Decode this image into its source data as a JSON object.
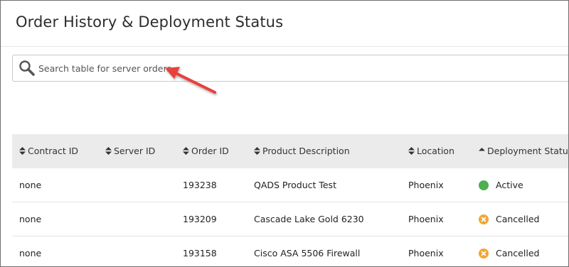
{
  "page": {
    "title": "Order History & Deployment Status"
  },
  "search": {
    "placeholder": "Search table for server orders",
    "value": ""
  },
  "table": {
    "columns": [
      {
        "label": "Contract ID",
        "sort": "both"
      },
      {
        "label": "Server ID",
        "sort": "both"
      },
      {
        "label": "Order ID",
        "sort": "both"
      },
      {
        "label": "Product Description",
        "sort": "both"
      },
      {
        "label": "Location",
        "sort": "both"
      },
      {
        "label": "Deployment Status",
        "sort": "asc"
      }
    ],
    "rows": [
      {
        "contract_id": "none",
        "server_id": "",
        "order_id": "193238",
        "product": "QADS Product Test",
        "location": "Phoenix",
        "status": "Active",
        "status_icon": "active-dot-icon"
      },
      {
        "contract_id": "none",
        "server_id": "",
        "order_id": "193209",
        "product": "Cascade Lake Gold 6230",
        "location": "Phoenix",
        "status": "Cancelled",
        "status_icon": "cancelled-x-icon"
      },
      {
        "contract_id": "none",
        "server_id": "",
        "order_id": "193158",
        "product": "Cisco ASA 5506 Firewall",
        "location": "Phoenix",
        "status": "Cancelled",
        "status_icon": "cancelled-x-icon"
      }
    ]
  },
  "colors": {
    "header_bg": "#ebebeb",
    "active": "#4caf50",
    "cancelled": "#f0a732",
    "annotation_arrow": "#e8403c"
  }
}
